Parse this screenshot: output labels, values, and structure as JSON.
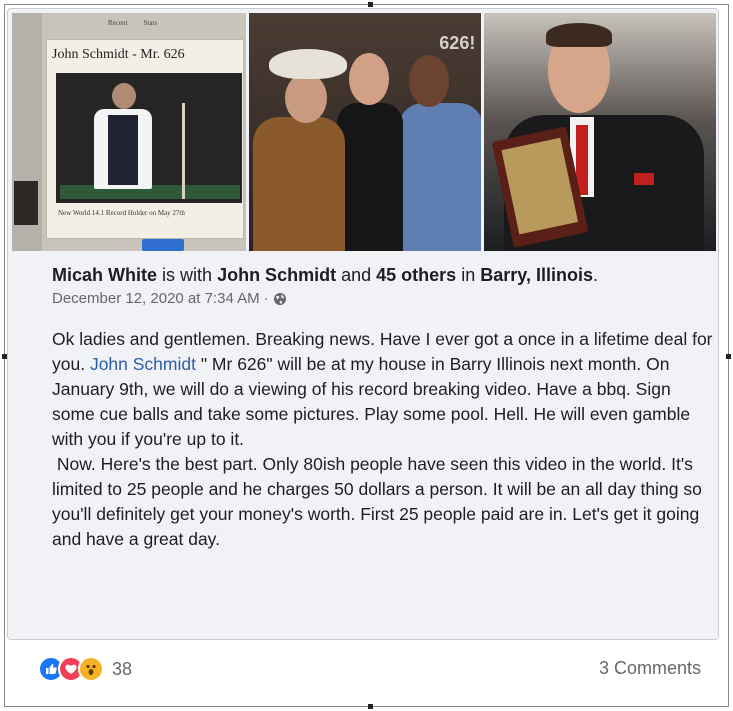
{
  "photos": {
    "photo1": {
      "tabs": [
        "Recent",
        "Stats"
      ],
      "title": "John Schmidt - Mr. 626",
      "caption": "New World 14.1 Record Holder on May 27th"
    },
    "photo2": {
      "sign_text": "626!"
    }
  },
  "post": {
    "author": "Micah White",
    "with_text": "is with",
    "tagged_person": "John Schmidt",
    "and_text": "and",
    "others": "45 others",
    "in_text": "in",
    "location": "Barry, Illinois",
    "period": ".",
    "timestamp": "December 12, 2020 at 7:34 AM",
    "separator": "·",
    "body_before_mention": "Ok ladies and gentlemen. Breaking news. Have I ever got a once in a lifetime deal for you.",
    "mention": "John Schmidt",
    "body_after_mention": "\" Mr 626\" will be at my house in Barry Illinois next month. On January 9th, we will do a viewing of his record breaking video. Have a bbq. Sign some cue balls and take some pictures.  Play some pool. Hell. He will even gamble with you if you're up to it.",
    "body_paragraph_2": "Now. Here's the best part. Only 80ish people have seen this video in the world. It's limited to 25 people and he charges 50 dollars a person. It will be an all day thing so you'll definitely get your money's worth. First 25 people paid are in. Let's get it going and have a great day."
  },
  "reactions": {
    "icons": [
      "like-icon",
      "love-icon",
      "wow-icon"
    ],
    "count": "38",
    "comments": "3 Comments"
  },
  "colors": {
    "like": "#1877f2",
    "love": "#f33e58",
    "wow": "#f7b125",
    "mention": "#2f5ea8",
    "meta": "#65676b"
  }
}
